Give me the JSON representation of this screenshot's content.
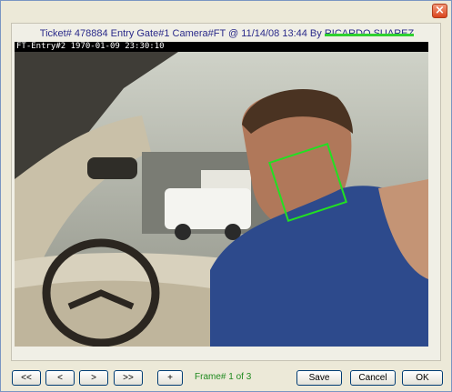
{
  "window": {
    "close_label": "×"
  },
  "header": {
    "text_prefix": "Ticket# 478884 Entry Gate#1 Camera#FT @ 11/14/08 13:44 By ",
    "redacted_name": "RICARDO SUAREZ",
    "redaction_color": "#2fd12f"
  },
  "camera": {
    "overlay": "FT-Entry#2 1970-01-09 23:30:10"
  },
  "controls": {
    "first_label": "<<",
    "prev_label": "<",
    "next_label": ">",
    "last_label": ">>",
    "add_label": "+",
    "frame_label": "Frame# 1 of 3",
    "save_label": "Save",
    "cancel_label": "Cancel",
    "ok_label": "OK"
  },
  "colors": {
    "face_box": "#22e022",
    "frame_text": "#1f8a1f",
    "header_text": "#2b2b8a"
  }
}
